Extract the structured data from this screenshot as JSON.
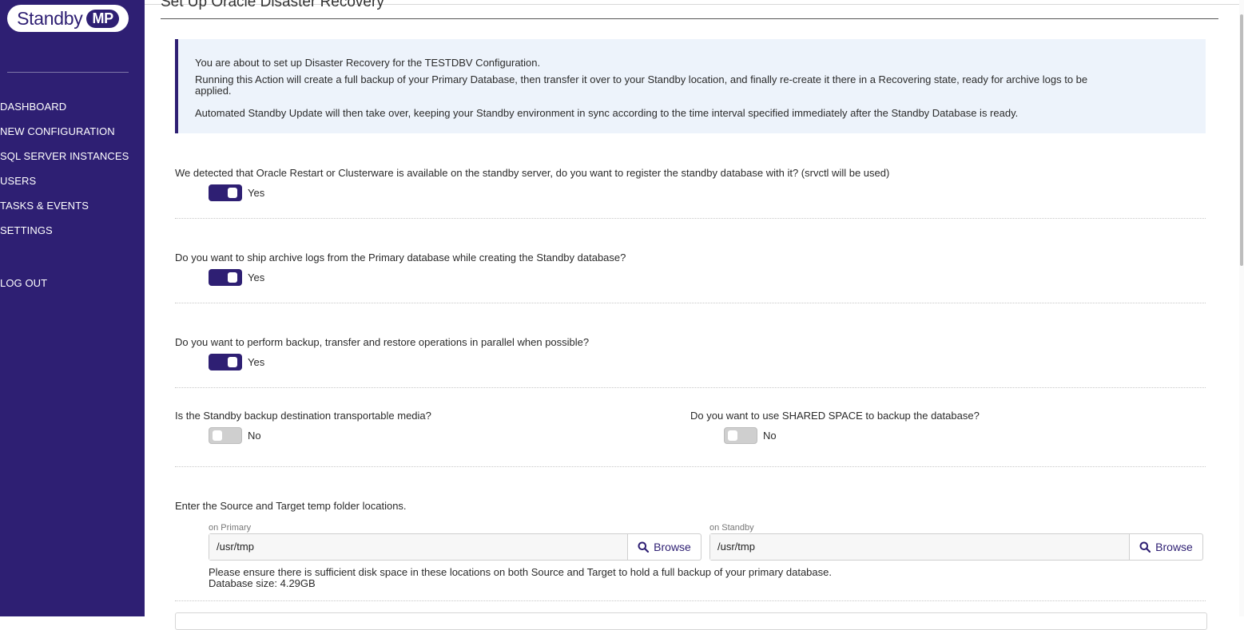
{
  "brand": {
    "name": "Standby",
    "badge": "MP"
  },
  "nav": [
    {
      "label": "DASHBOARD"
    },
    {
      "label": "NEW CONFIGURATION"
    },
    {
      "label": "SQL SERVER INSTANCES"
    },
    {
      "label": "USERS"
    },
    {
      "label": "TASKS & EVENTS"
    },
    {
      "label": "SETTINGS"
    },
    {
      "label": "LOG OUT"
    }
  ],
  "page": {
    "title": "Set Up Oracle Disaster Recovery"
  },
  "info": {
    "line1": "You are about to set up Disaster Recovery for the TESTDBV Configuration.",
    "line2a": "Running this Action will create a full backup of your Primary Database, then transfer it over to your Standby location, and finally re-create it there in a Recovering state, ready for archive logs to be",
    "line2b": "applied.",
    "line3": "Automated Standby Update will then take over, keeping your Standby environment in sync according to the time interval specified immediately after the Standby Database is ready."
  },
  "questions": {
    "q1": {
      "text": "We detected that Oracle Restart or Clusterware is available on the standby server, do you want to register the standby database with it? (srvctl will be used)",
      "state": "Yes"
    },
    "q2": {
      "text": "Do you want to ship archive logs from the Primary database while creating the Standby database?",
      "state": "Yes"
    },
    "q3": {
      "text": "Do you want to perform backup, transfer and restore operations in parallel when possible?",
      "state": "Yes"
    },
    "q4": {
      "text": "Is the Standby backup destination transportable media?",
      "state": "No"
    },
    "q5": {
      "text": "Do you want to use SHARED SPACE to backup the database?",
      "state": "No"
    }
  },
  "temp": {
    "prompt": "Enter the Source and Target temp folder locations.",
    "primary": {
      "label": "on Primary",
      "value": "/usr/tmp",
      "button": "Browse"
    },
    "standby": {
      "label": "on Standby",
      "value": "/usr/tmp",
      "button": "Browse"
    },
    "note1": "Please ensure there is sufficient disk space in these locations on both Source and Target to hold a full backup of your primary database.",
    "note2": "Database size: 4.29GB"
  },
  "colors": {
    "brand": "#2e1f73",
    "info_bg": "#edf3fb"
  }
}
